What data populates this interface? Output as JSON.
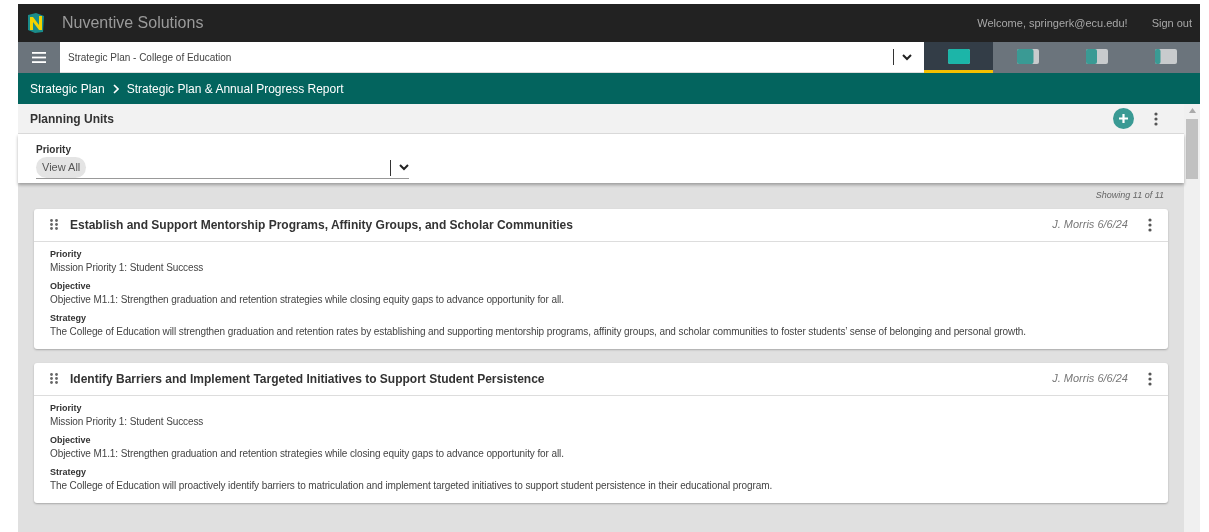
{
  "header": {
    "app_name": "Nuventive Solutions",
    "welcome": "Welcome, springerk@ecu.edu!",
    "sign_out": "Sign out"
  },
  "plan_select": {
    "value": "Strategic Plan - College of Education"
  },
  "views": [
    {
      "selected": true
    },
    {
      "selected": false
    },
    {
      "selected": false
    },
    {
      "selected": false
    }
  ],
  "breadcrumb": [
    "Strategic Plan",
    "Strategic Plan & Annual Progress Report"
  ],
  "section": {
    "title": "Planning Units"
  },
  "filter": {
    "label": "Priority",
    "chip": "View All"
  },
  "count": "Showing 11 of 11",
  "cards": [
    {
      "title": "Establish and Support Mentorship Programs, Affinity Groups, and Scholar Communities",
      "meta": "J. Morris 6/6/24",
      "fields": [
        {
          "label": "Priority",
          "value": "Mission Priority 1: Student Success"
        },
        {
          "label": "Objective",
          "value": "Objective M1.1: Strengthen graduation and retention strategies while closing equity gaps to advance opportunity for all."
        },
        {
          "label": "Strategy",
          "value": "The College of Education will strengthen graduation and retention rates by establishing and supporting mentorship programs, affinity groups, and scholar communities to foster students’ sense of belonging and personal growth."
        }
      ]
    },
    {
      "title": "Identify Barriers and Implement Targeted Initiatives to Support Student Persistence",
      "meta": "J. Morris 6/6/24",
      "fields": [
        {
          "label": "Priority",
          "value": "Mission Priority 1: Student Success"
        },
        {
          "label": "Objective",
          "value": "Objective M1.1: Strengthen graduation and retention strategies while closing equity gaps to advance opportunity for all."
        },
        {
          "label": "Strategy",
          "value": "The College of Education will proactively identify barriers to matriculation and implement targeted initiatives to support student persistence in their educational program."
        }
      ]
    }
  ]
}
